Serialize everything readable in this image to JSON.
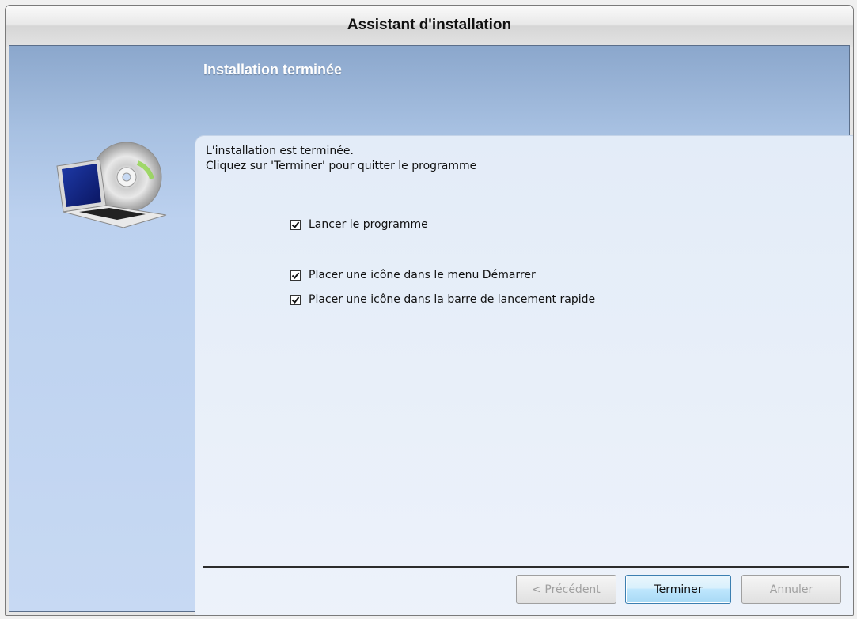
{
  "window": {
    "title": "Assistant d'installation"
  },
  "header": {
    "heading": "Installation terminée"
  },
  "message": {
    "line1": "L'installation est terminée.",
    "line2": "Cliquez sur 'Terminer' pour quitter le programme"
  },
  "options": [
    {
      "label": "Lancer le programme",
      "checked": true
    },
    {
      "label": "Placer une icône dans le menu Démarrer",
      "checked": true
    },
    {
      "label": "Placer une icône dans la barre de lancement rapide",
      "checked": true
    }
  ],
  "buttons": {
    "previous": "< Précédent",
    "finish": "Terminer",
    "cancel": "Annuler"
  },
  "icons": {
    "installer": "computer-cd-icon",
    "checkbox": "check-icon"
  }
}
